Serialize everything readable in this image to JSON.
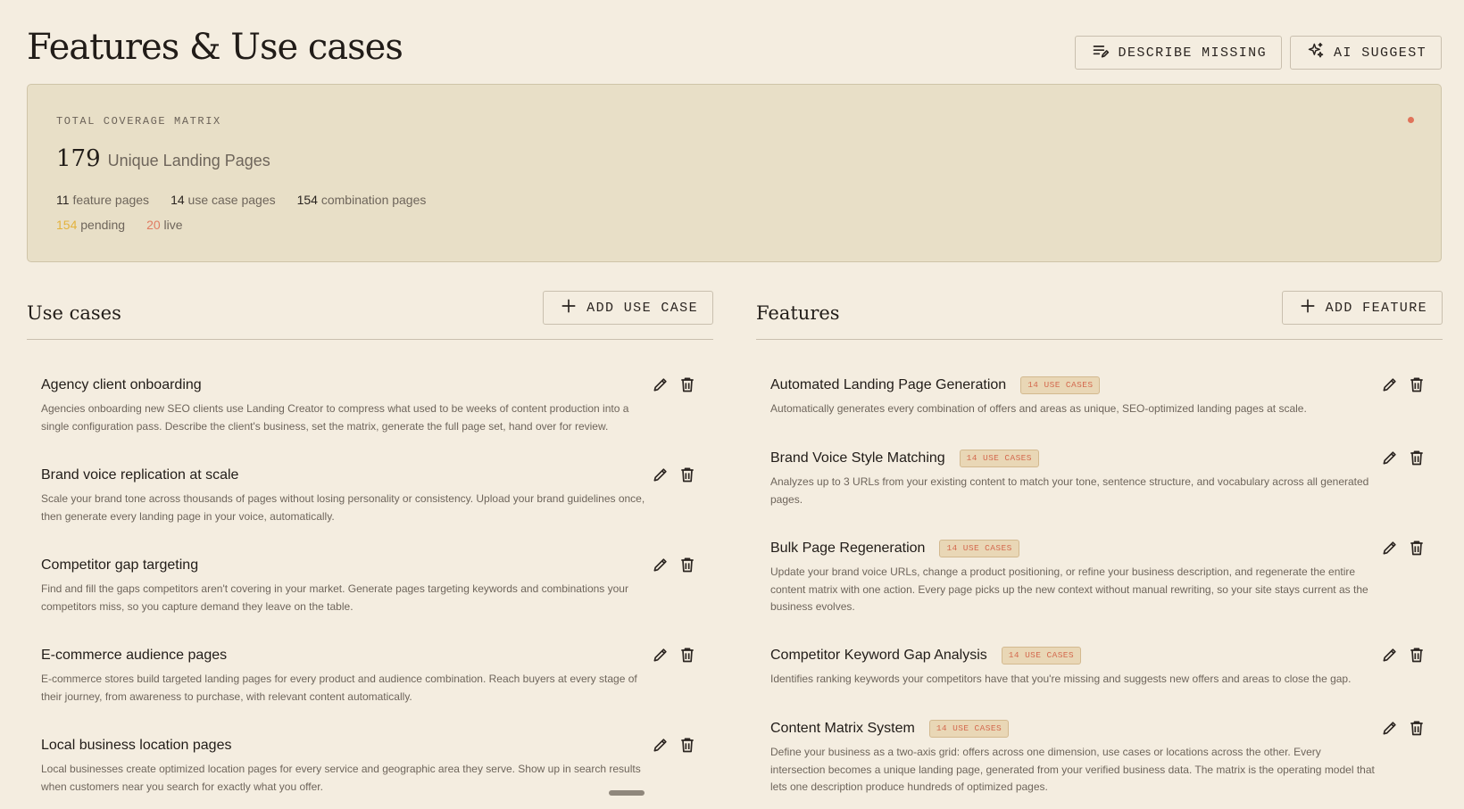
{
  "header": {
    "title": "Features & Use cases",
    "describe_missing": "DESCRIBE MISSING",
    "ai_suggest": "AI SUGGEST"
  },
  "matrix": {
    "label": "TOTAL COVERAGE MATRIX",
    "total": "179",
    "total_label": "Unique Landing Pages",
    "feature_pages": {
      "num": "11",
      "label": "feature pages"
    },
    "use_case_pages": {
      "num": "14",
      "label": "use case pages"
    },
    "combination_pages": {
      "num": "154",
      "label": "combination pages"
    },
    "pending": {
      "num": "154",
      "label": "pending"
    },
    "live": {
      "num": "20",
      "label": "live"
    },
    "status_color": "#e0735a"
  },
  "use_cases": {
    "title": "Use cases",
    "add_label": "ADD USE CASE",
    "items": [
      {
        "title": "Agency client onboarding",
        "desc": "Agencies onboarding new SEO clients use Landing Creator to compress what used to be weeks of content production into a single configuration pass. Describe the client's business, set the matrix, generate the full page set, hand over for review."
      },
      {
        "title": "Brand voice replication at scale",
        "desc": "Scale your brand tone across thousands of pages without losing personality or consistency. Upload your brand guidelines once, then generate every landing page in your voice, automatically."
      },
      {
        "title": "Competitor gap targeting",
        "desc": "Find and fill the gaps competitors aren't covering in your market. Generate pages targeting keywords and combinations your competitors miss, so you capture demand they leave on the table."
      },
      {
        "title": "E-commerce audience pages",
        "desc": "E-commerce stores build targeted landing pages for every product and audience combination. Reach buyers at every stage of their journey, from awareness to purchase, with relevant content automatically."
      },
      {
        "title": "Local business location pages",
        "desc": "Local businesses create optimized location pages for every service and geographic area they serve. Show up in search results when customers near you search for exactly what you offer."
      }
    ]
  },
  "features": {
    "title": "Features",
    "add_label": "ADD FEATURE",
    "items": [
      {
        "title": "Automated Landing Page Generation",
        "badge": "14 USE CASES",
        "desc": "Automatically generates every combination of offers and areas as unique, SEO-optimized landing pages at scale."
      },
      {
        "title": "Brand Voice Style Matching",
        "badge": "14 USE CASES",
        "desc": "Analyzes up to 3 URLs from your existing content to match your tone, sentence structure, and vocabulary across all generated pages."
      },
      {
        "title": "Bulk Page Regeneration",
        "badge": "14 USE CASES",
        "desc": "Update your brand voice URLs, change a product positioning, or refine your business description, and regenerate the entire content matrix with one action. Every page picks up the new context without manual rewriting, so your site stays current as the business evolves."
      },
      {
        "title": "Competitor Keyword Gap Analysis",
        "badge": "14 USE CASES",
        "desc": "Identifies ranking keywords your competitors have that you're missing and suggests new offers and areas to close the gap."
      },
      {
        "title": "Content Matrix System",
        "badge": "14 USE CASES",
        "desc": "Define your business as a two-axis grid: offers across one dimension, use cases or locations across the other. Every intersection becomes a unique landing page, generated from your verified business data. The matrix is the operating model that lets one description produce hundreds of optimized pages."
      }
    ]
  }
}
